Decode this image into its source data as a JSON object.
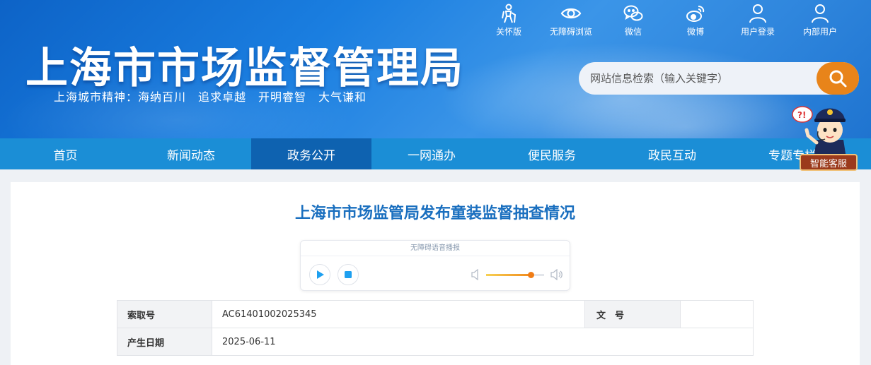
{
  "header": {
    "site_title": "上海市市场监督管理局",
    "slogan": "上海城市精神：海纳百川　追求卓越　开明睿智　大气谦和",
    "top_links": [
      {
        "label": "关怀版",
        "icon": "elderly-care-icon"
      },
      {
        "label": "无障碍浏览",
        "icon": "eye-icon"
      },
      {
        "label": "微信",
        "icon": "wechat-icon"
      },
      {
        "label": "微博",
        "icon": "weibo-icon"
      },
      {
        "label": "用户登录",
        "icon": "user-icon"
      },
      {
        "label": "内部用户",
        "icon": "user-icon"
      }
    ],
    "search_placeholder": "网站信息检索（输入关键字）"
  },
  "nav": {
    "items": [
      {
        "label": "首页"
      },
      {
        "label": "新闻动态"
      },
      {
        "label": "政务公开"
      },
      {
        "label": "一网通办"
      },
      {
        "label": "便民服务"
      },
      {
        "label": "政民互动"
      },
      {
        "label": "专题专栏"
      }
    ],
    "active_index": 2
  },
  "assistant": {
    "label": "智能客服"
  },
  "article": {
    "title": "上海市市场监管局发布童装监督抽查情况",
    "player": {
      "label": "无障碍语音播报",
      "volume": 0.78
    },
    "meta_table": {
      "rows": [
        {
          "label1": "索取号",
          "value1": "AC61401002025345",
          "label2": "文　号",
          "value2": ""
        },
        {
          "label1": "产生日期",
          "value1": "2025-06-11"
        }
      ]
    }
  },
  "colors": {
    "nav_bg": "#1b8ed6",
    "nav_active": "#0e62b0",
    "title_blue": "#1a6fbf",
    "search_button": "#e8841a"
  }
}
